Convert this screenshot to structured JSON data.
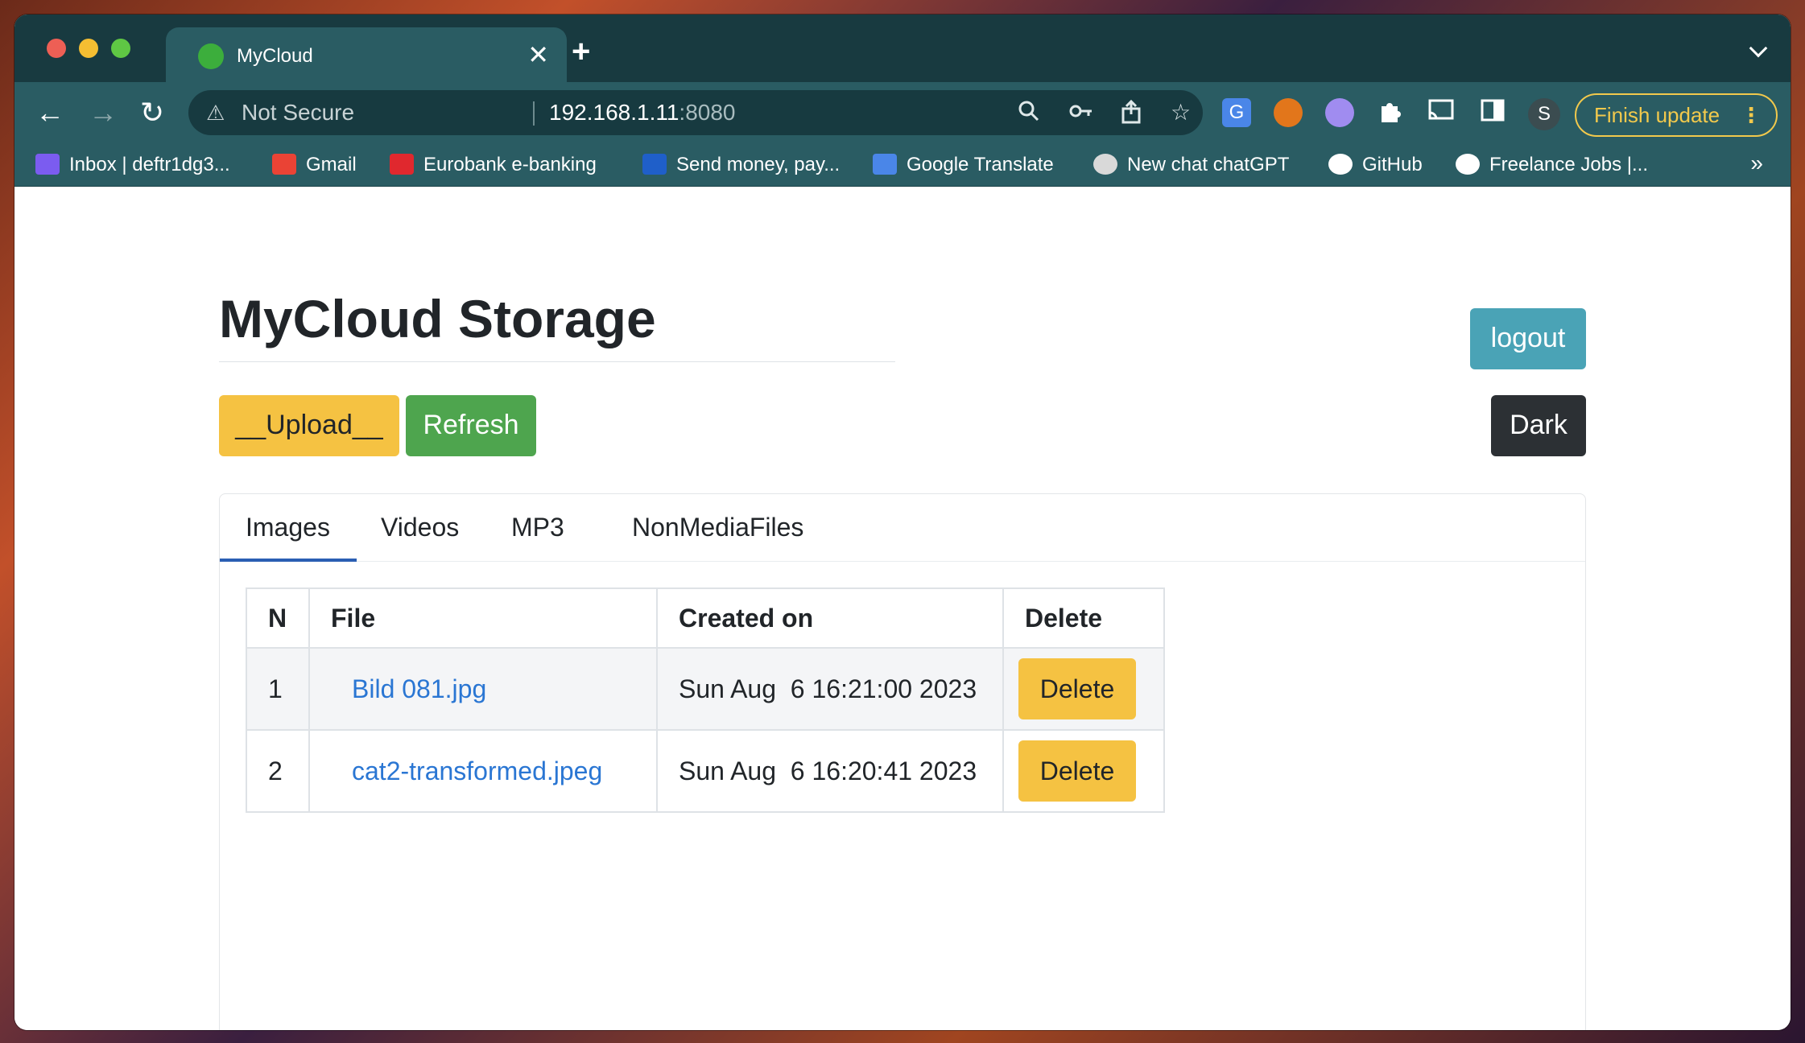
{
  "browser": {
    "tab_title": "MyCloud",
    "tab_close": "✕",
    "new_tab": "+",
    "nav_back": "←",
    "nav_forward": "→",
    "nav_reload": "↻",
    "security_label": "Not Secure",
    "url_host": "192.168.1.11",
    "url_port": ":8080",
    "profile_initial": "S",
    "finish_update_label": "Finish update",
    "finish_update_menu": "⋮",
    "bookmarks_more": "»",
    "bookmarks": [
      {
        "label": "Inbox | deftr1dg3...",
        "icon": "proton-mail-icon",
        "color": "#7b5cf0"
      },
      {
        "label": "Gmail",
        "icon": "gmail-icon",
        "color": "#ea4335"
      },
      {
        "label": "Eurobank e-banking",
        "icon": "eurobank-icon",
        "color": "#e0282e"
      },
      {
        "label": "Send money, pay...",
        "icon": "paypal-icon",
        "color": "#1f5fc9"
      },
      {
        "label": "Google Translate",
        "icon": "google-translate-icon",
        "color": "#4a86e8"
      },
      {
        "label": "New chat chatGPT",
        "icon": "chatgpt-icon",
        "color": "#d9d9d9"
      },
      {
        "label": "GitHub",
        "icon": "github-icon",
        "color": "#ffffff"
      },
      {
        "label": "Freelance Jobs |...",
        "icon": "freelancer-icon",
        "color": "#ffffff"
      }
    ]
  },
  "app": {
    "title": "MyCloud Storage",
    "logout_label": "logout",
    "dark_label": "Dark",
    "upload_label": "__Upload__",
    "refresh_label": "Refresh",
    "tabs": [
      {
        "label": "Images",
        "active": true
      },
      {
        "label": "Videos",
        "active": false
      },
      {
        "label": "MP3",
        "active": false
      },
      {
        "label": "NonMediaFiles",
        "active": false
      }
    ],
    "table": {
      "headers": [
        "N",
        "File",
        "Created on",
        "Delete"
      ],
      "rows": [
        {
          "n": "1",
          "file": "Bild 081.jpg",
          "created": "Sun Aug  6 16:21:00 2023",
          "action": "Delete"
        },
        {
          "n": "2",
          "file": "cat2-transformed.jpeg",
          "created": "Sun Aug  6 16:20:41 2023",
          "action": "Delete"
        }
      ]
    }
  },
  "colors": {
    "tab_strip": "#183a40",
    "toolbar": "#2a5c63",
    "upload": "#f5c242",
    "refresh": "#4ea54e",
    "logout": "#4aa3b6",
    "dark": "#2c3034",
    "link": "#2a76d3"
  }
}
